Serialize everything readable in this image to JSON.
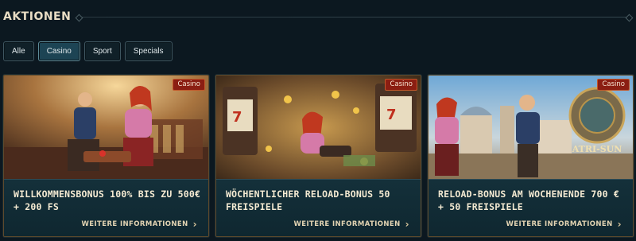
{
  "header": {
    "title": "AKTIONEN"
  },
  "filters": [
    {
      "label": "Alle",
      "active": false
    },
    {
      "label": "Casino",
      "active": true
    },
    {
      "label": "Sport",
      "active": false
    },
    {
      "label": "Specials",
      "active": false
    }
  ],
  "cards": [
    {
      "badge": "Casino",
      "title": "WILLKOMMENSBONUS 100% BIS ZU 500€ + 200 FS",
      "link": "WEITERE INFORMATIONEN"
    },
    {
      "badge": "Casino",
      "title": "WÖCHENTLICHER RELOAD-BONUS 50 FREISPIELE",
      "link": "WEITERE INFORMATIONEN"
    },
    {
      "badge": "Casino",
      "title": "RELOAD-BONUS AM WOCHENENDE 700 € + 50 FREISPIELE",
      "link": "WEITERE INFORMATIONEN",
      "logo_text": "ATRI-SUN"
    }
  ],
  "colors": {
    "background": "#0c1820",
    "badge": "#8b1e12",
    "active_filter": "#1d4454",
    "card_border": "#5e4a2c"
  }
}
